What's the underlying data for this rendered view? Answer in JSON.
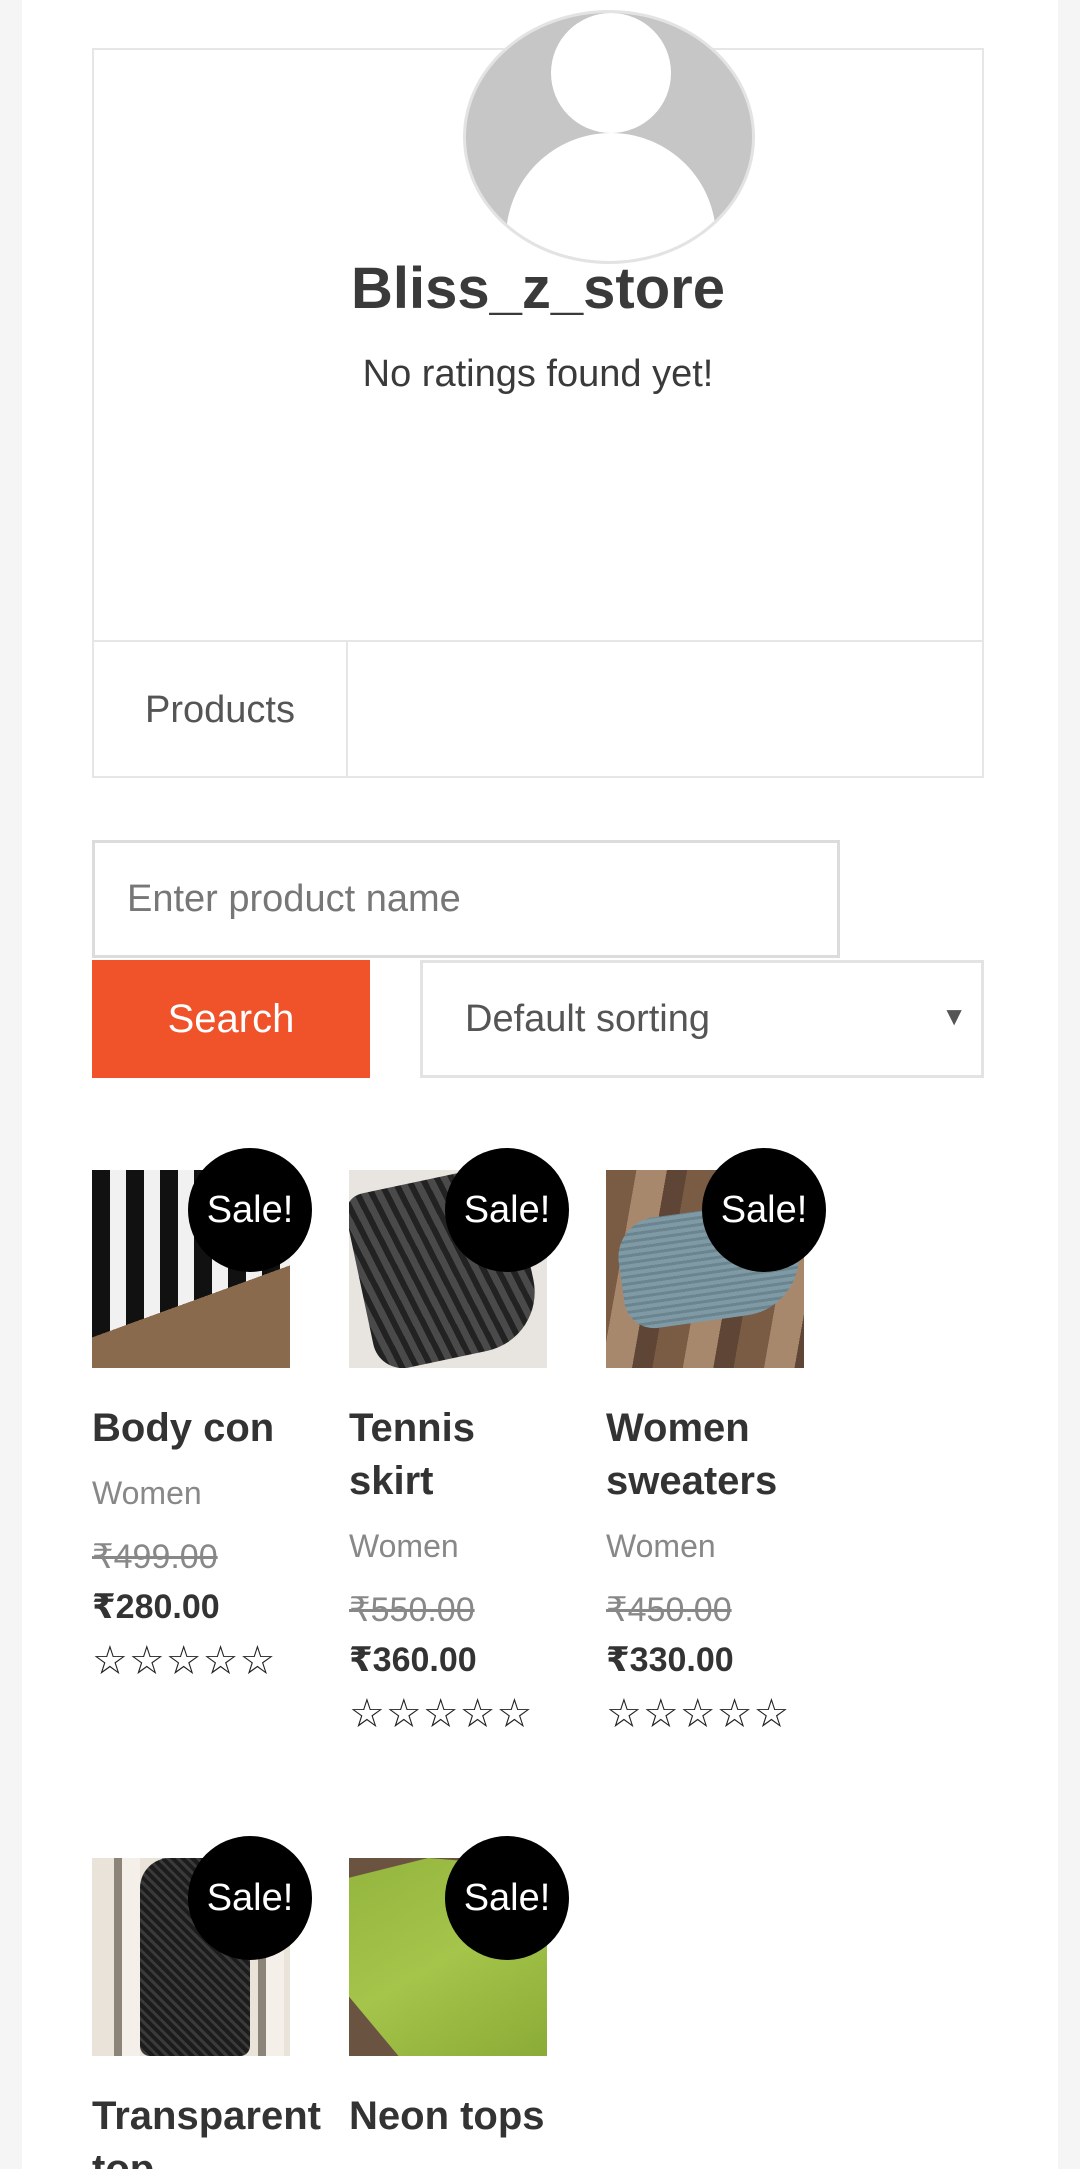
{
  "store": {
    "name": "Bliss_z_store",
    "rating_note": "No ratings found yet!",
    "tabs": [
      {
        "label": "Products"
      }
    ]
  },
  "search": {
    "placeholder": "Enter product name",
    "button_label": "Search"
  },
  "sort": {
    "selected": "Default sorting",
    "arrow": "▼"
  },
  "products": [
    {
      "title": "Body con",
      "category": "Women",
      "old_price": "₹499.00",
      "price": "₹280.00",
      "badge": "Sale!",
      "rating_stars": "☆☆☆☆☆"
    },
    {
      "title": "Tennis skirt",
      "category": "Women",
      "old_price": "₹550.00",
      "price": "₹360.00",
      "badge": "Sale!",
      "rating_stars": "☆☆☆☆☆"
    },
    {
      "title": "Women sweaters",
      "category": "Women",
      "old_price": "₹450.00",
      "price": "₹330.00",
      "badge": "Sale!",
      "rating_stars": "☆☆☆☆☆"
    },
    {
      "title": "Transparent top",
      "badge": "Sale!"
    },
    {
      "title": "Neon tops",
      "badge": "Sale!"
    }
  ],
  "colors": {
    "accent": "#f0522a",
    "badge": "#000000",
    "border": "#e6e6e6"
  }
}
